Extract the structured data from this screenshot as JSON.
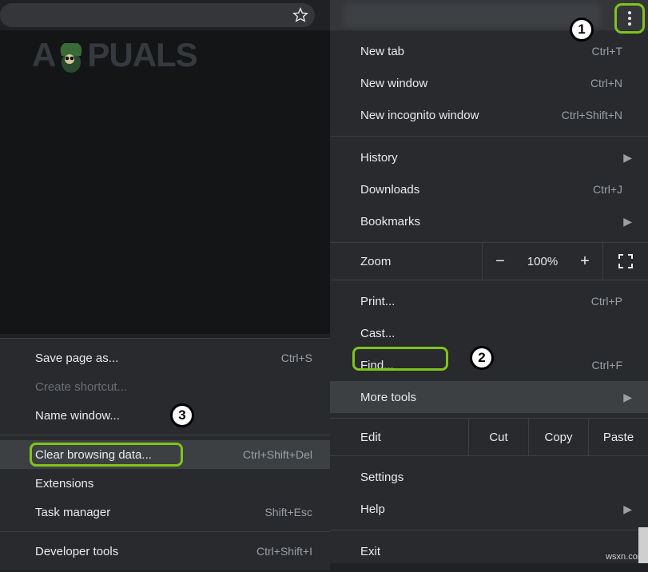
{
  "callouts": {
    "one": "1",
    "two": "2",
    "three": "3"
  },
  "mainmenu": {
    "new_tab": {
      "label": "New tab",
      "shortcut": "Ctrl+T"
    },
    "new_window": {
      "label": "New window",
      "shortcut": "Ctrl+N"
    },
    "new_incognito": {
      "label": "New incognito window",
      "shortcut": "Ctrl+Shift+N"
    },
    "history": {
      "label": "History"
    },
    "downloads": {
      "label": "Downloads",
      "shortcut": "Ctrl+J"
    },
    "bookmarks": {
      "label": "Bookmarks"
    },
    "zoom": {
      "label": "Zoom",
      "value": "100%",
      "minus": "−",
      "plus": "+"
    },
    "print": {
      "label": "Print...",
      "shortcut": "Ctrl+P"
    },
    "cast": {
      "label": "Cast..."
    },
    "find": {
      "label": "Find...",
      "shortcut": "Ctrl+F"
    },
    "more_tools": {
      "label": "More tools"
    },
    "edit": {
      "label": "Edit",
      "cut": "Cut",
      "copy": "Copy",
      "paste": "Paste"
    },
    "settings": {
      "label": "Settings"
    },
    "help": {
      "label": "Help"
    },
    "exit": {
      "label": "Exit"
    }
  },
  "submenu": {
    "save_page": {
      "label": "Save page as...",
      "shortcut": "Ctrl+S"
    },
    "create_shortcut": {
      "label": "Create shortcut..."
    },
    "name_window": {
      "label": "Name window..."
    },
    "clear_browsing": {
      "label": "Clear browsing data...",
      "shortcut": "Ctrl+Shift+Del"
    },
    "extensions": {
      "label": "Extensions"
    },
    "task_manager": {
      "label": "Task manager",
      "shortcut": "Shift+Esc"
    },
    "developer_tools": {
      "label": "Developer tools",
      "shortcut": "Ctrl+Shift+I"
    }
  },
  "logo_text": {
    "a1": "A",
    "rest": "PUALS"
  },
  "watermark": "wsxn.com"
}
